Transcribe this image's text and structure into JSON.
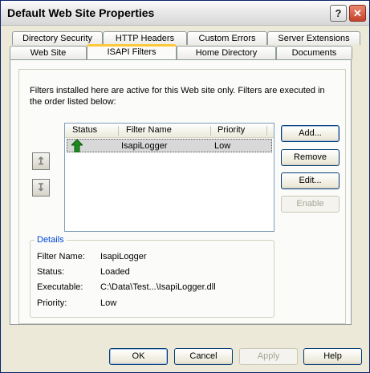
{
  "window": {
    "title": "Default Web Site Properties"
  },
  "tabs": {
    "row1": [
      "Directory Security",
      "HTTP Headers",
      "Custom Errors",
      "Server Extensions"
    ],
    "row2": [
      "Web Site",
      "ISAPI Filters",
      "Home Directory",
      "Documents"
    ],
    "active": "ISAPI Filters"
  },
  "description": "Filters installed here are active for this Web site only. Filters are executed in the order listed below:",
  "filters": {
    "columns": [
      "Status",
      "Filter Name",
      "Priority"
    ],
    "rows": [
      {
        "status_icon": "green-up-arrow-icon",
        "name": "IsapiLogger",
        "priority": "Low"
      }
    ]
  },
  "buttons": {
    "add": "Add...",
    "remove": "Remove",
    "edit": "Edit...",
    "enable": "Enable",
    "ok": "OK",
    "cancel": "Cancel",
    "apply": "Apply",
    "help": "Help"
  },
  "details": {
    "group_label": "Details",
    "filter_name_label": "Filter Name:",
    "filter_name_value": "IsapiLogger",
    "status_label": "Status:",
    "status_value": "Loaded",
    "executable_label": "Executable:",
    "executable_value": "C:\\Data\\Test...\\IsapiLogger.dll",
    "priority_label": "Priority:",
    "priority_value": "Low"
  },
  "colors": {
    "accent_tab": "#ffc83c",
    "group_label": "#0046d5",
    "status_icon": "#1e8a1e"
  }
}
